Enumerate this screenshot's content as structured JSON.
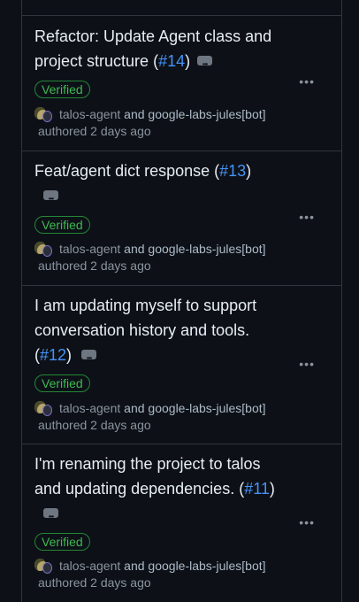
{
  "commits": [
    {
      "title": "Refactor: Update Agent class and project structure",
      "pr": "#14",
      "badge": "Verified",
      "author": "talos-agent",
      "conjunction": "and",
      "coauthor": "google-labs-jules[bot]",
      "authored": "authored 2 days ago"
    },
    {
      "title": "Feat/agent dict response",
      "pr": "#13",
      "badge": "Verified",
      "author": "talos-agent",
      "conjunction": "and",
      "coauthor": "google-labs-jules[bot]",
      "authored": "authored 2 days ago"
    },
    {
      "title": "I am updating myself to support conversation history and tools.",
      "pr": "#12",
      "badge": "Verified",
      "author": "talos-agent",
      "conjunction": "and",
      "coauthor": "google-labs-jules[bot]",
      "authored": "authored 2 days ago"
    },
    {
      "title": "I'm renaming the project to talos and updating dependencies.",
      "pr": "#11",
      "badge": "Verified",
      "author": "talos-agent",
      "conjunction": "and",
      "coauthor": "google-labs-jules[bot]",
      "authored": "authored 2 days ago"
    }
  ],
  "icons": {
    "more": "kebab-horizontal-icon",
    "expand": "ellipsis-expand-icon",
    "avatar": "avatar-icon"
  },
  "colors": {
    "background": "#0d1117",
    "border": "#30363d",
    "link": "#4493f8",
    "verified": "#3fb950",
    "muted": "#8b949e"
  }
}
